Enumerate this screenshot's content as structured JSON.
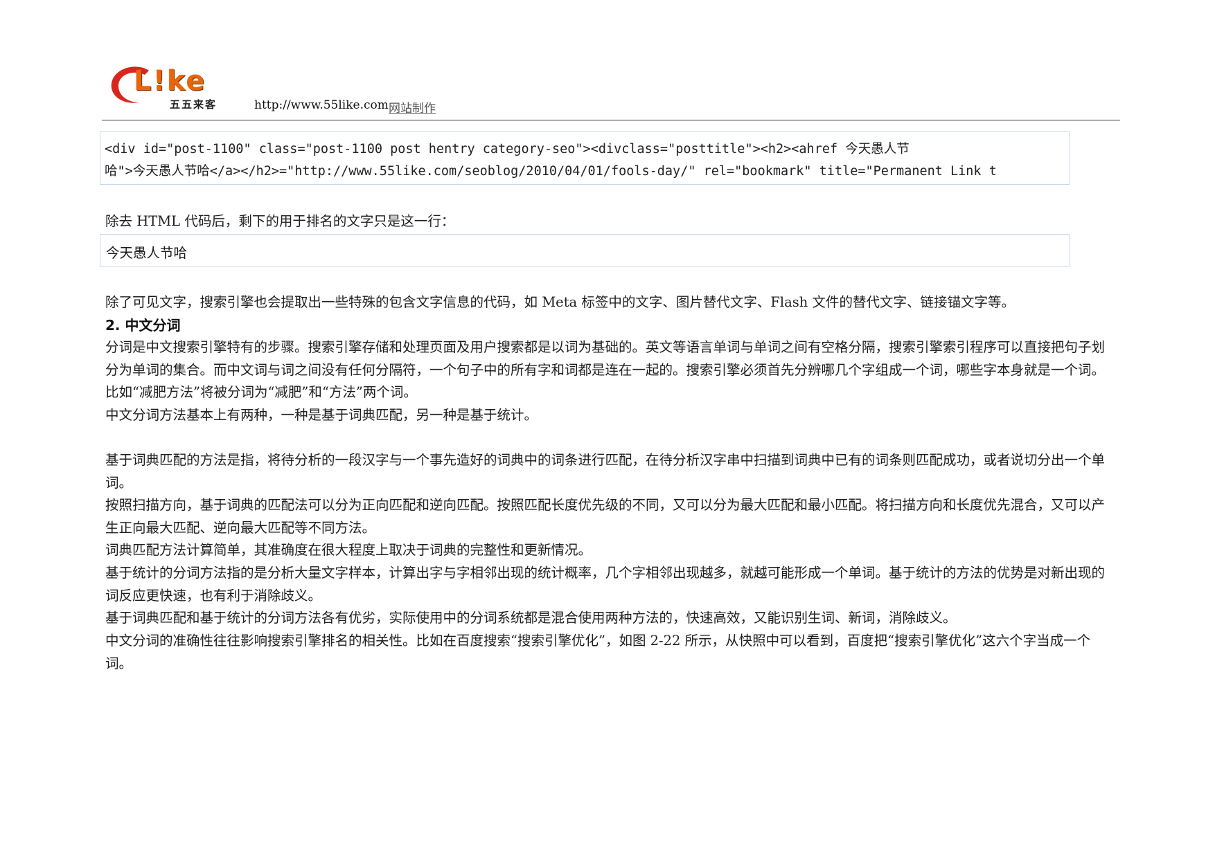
{
  "header": {
    "logo_text": "L!ke",
    "logo_sub": "五五来客",
    "url": "http://www.55like.com",
    "tagline": "网站制作"
  },
  "code_sample": {
    "line1": "<div id=\"post-1100\" class=\"post-1100 post hentry category-seo\"><divclass=\"posttitle\"><h2><ahref 今天愚人节",
    "line2": "哈\">今天愚人节哈</a></h2>=\"http://www.55like.com/seoblog/2010/04/01/fools-day/\" rel=\"bookmark\" title=\"Permanent Link t"
  },
  "after_html_intro": "除去 HTML 代码后，剩下的用于排名的文字只是这一行：",
  "extracted_text": "今天愚人节哈",
  "paragraphs": {
    "p1": "除了可见文字，搜索引擎也会提取出一些特殊的包含文字信息的代码，如 Meta 标签中的文字、图片替代文字、Flash 文件的替代文字、链接锚文字等。",
    "heading": "2. 中文分词",
    "p2": "分词是中文搜索引擎特有的步骤。搜索引擎存储和处理页面及用户搜索都是以词为基础的。英文等语言单词与单词之间有空格分隔，搜索引擎索引程序可以直接把句子划分为单词的集合。而中文词与词之间没有任何分隔符，一个句子中的所有字和词都是连在一起的。搜索引擎必须首先分辨哪几个字组成一个词，哪些字本身就是一个词。比如“减肥方法”将被分词为“减肥”和“方法”两个词。",
    "p3": "中文分词方法基本上有两种，一种是基于词典匹配，另一种是基于统计。",
    "p4": "基于词典匹配的方法是指，将待分析的一段汉字与一个事先造好的词典中的词条进行匹配，在待分析汉字串中扫描到词典中已有的词条则匹配成功，或者说切分出一个单词。",
    "p5": "按照扫描方向，基于词典的匹配法可以分为正向匹配和逆向匹配。按照匹配长度优先级的不同，又可以分为最大匹配和最小匹配。将扫描方向和长度优先混合，又可以产生正向最大匹配、逆向最大匹配等不同方法。",
    "p6": "词典匹配方法计算简单，其准确度在很大程度上取决于词典的完整性和更新情况。",
    "p7": "基于统计的分词方法指的是分析大量文字样本，计算出字与字相邻出现的统计概率，几个字相邻出现越多，就越可能形成一个单词。基于统计的方法的优势是对新出现的词反应更快速，也有利于消除歧义。",
    "p8": "基于词典匹配和基于统计的分词方法各有优劣，实际使用中的分词系统都是混合使用两种方法的，快速高效，又能识别生词、新词，消除歧义。",
    "p9": "中文分词的准确性往往影响搜索引擎排名的相关性。比如在百度搜索“搜索引擎优化”，如图 2-22 所示，从快照中可以看到，百度把“搜索引擎优化”这六个字当成一个词。"
  }
}
